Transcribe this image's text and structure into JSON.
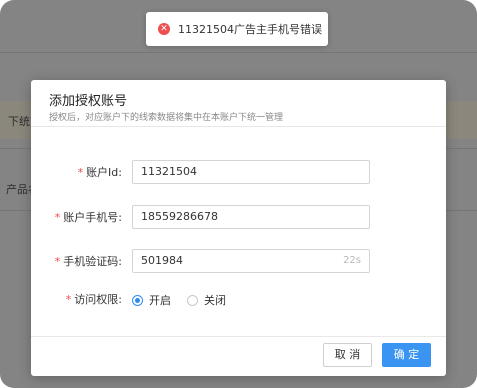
{
  "background": {
    "fragment1": "下统",
    "fragment2": "产品名"
  },
  "toast": {
    "icon": "error-circle-icon",
    "message": "11321504广告主手机号错误"
  },
  "dialog": {
    "title": "添加授权账号",
    "subtitle": "授权后，对应账户下的线索数据将集中在本账户下统一管理",
    "fields": {
      "account_id": {
        "required": "*",
        "label": "账户Id:",
        "value": "11321504"
      },
      "phone": {
        "required": "*",
        "label": "账户手机号:",
        "value": "18559286678"
      },
      "code": {
        "required": "*",
        "label": "手机验证码:",
        "value": "501984",
        "countdown": "22s"
      },
      "access": {
        "required": "*",
        "label": "访问权限:",
        "options": [
          {
            "label": "开启",
            "checked": true
          },
          {
            "label": "关闭",
            "checked": false
          }
        ]
      }
    },
    "buttons": {
      "cancel": "取 消",
      "ok": "确 定"
    }
  },
  "colors": {
    "primary": "#3a95f2",
    "error": "#ed4f4f",
    "required": "#f04848"
  }
}
